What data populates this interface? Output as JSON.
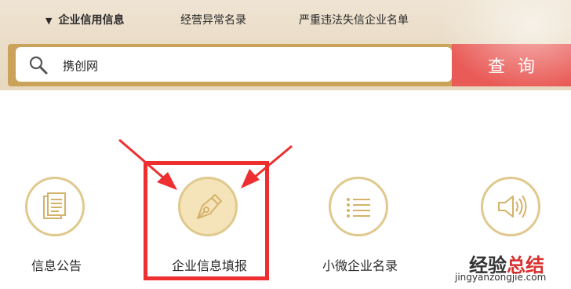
{
  "nav": {
    "tabs": [
      {
        "label": "企业信用信息",
        "active": true
      },
      {
        "label": "经营异常名录",
        "active": false
      },
      {
        "label": "严重违法失信企业名单",
        "active": false
      }
    ],
    "active_indicator": "▼"
  },
  "search": {
    "value": "携创网",
    "icon": "magnifier-icon",
    "button_label": "查询"
  },
  "features": [
    {
      "label": "信息公告",
      "icon": "document-icon"
    },
    {
      "label": "企业信息填报",
      "icon": "pen-nib-icon",
      "highlighted": true
    },
    {
      "label": "小微企业名录",
      "icon": "list-icon"
    },
    {
      "label": "",
      "icon": "speaker-icon"
    }
  ],
  "watermark": {
    "title_part1": "经验",
    "title_part2": "总结",
    "url": "jingyanzongjie.com"
  },
  "colors": {
    "header_bg": "#eadcc6",
    "search_border": "#caa25a",
    "search_button": "#e95b57",
    "icon_gold": "#d4b26a",
    "annotation_red": "#ee2f2f"
  }
}
